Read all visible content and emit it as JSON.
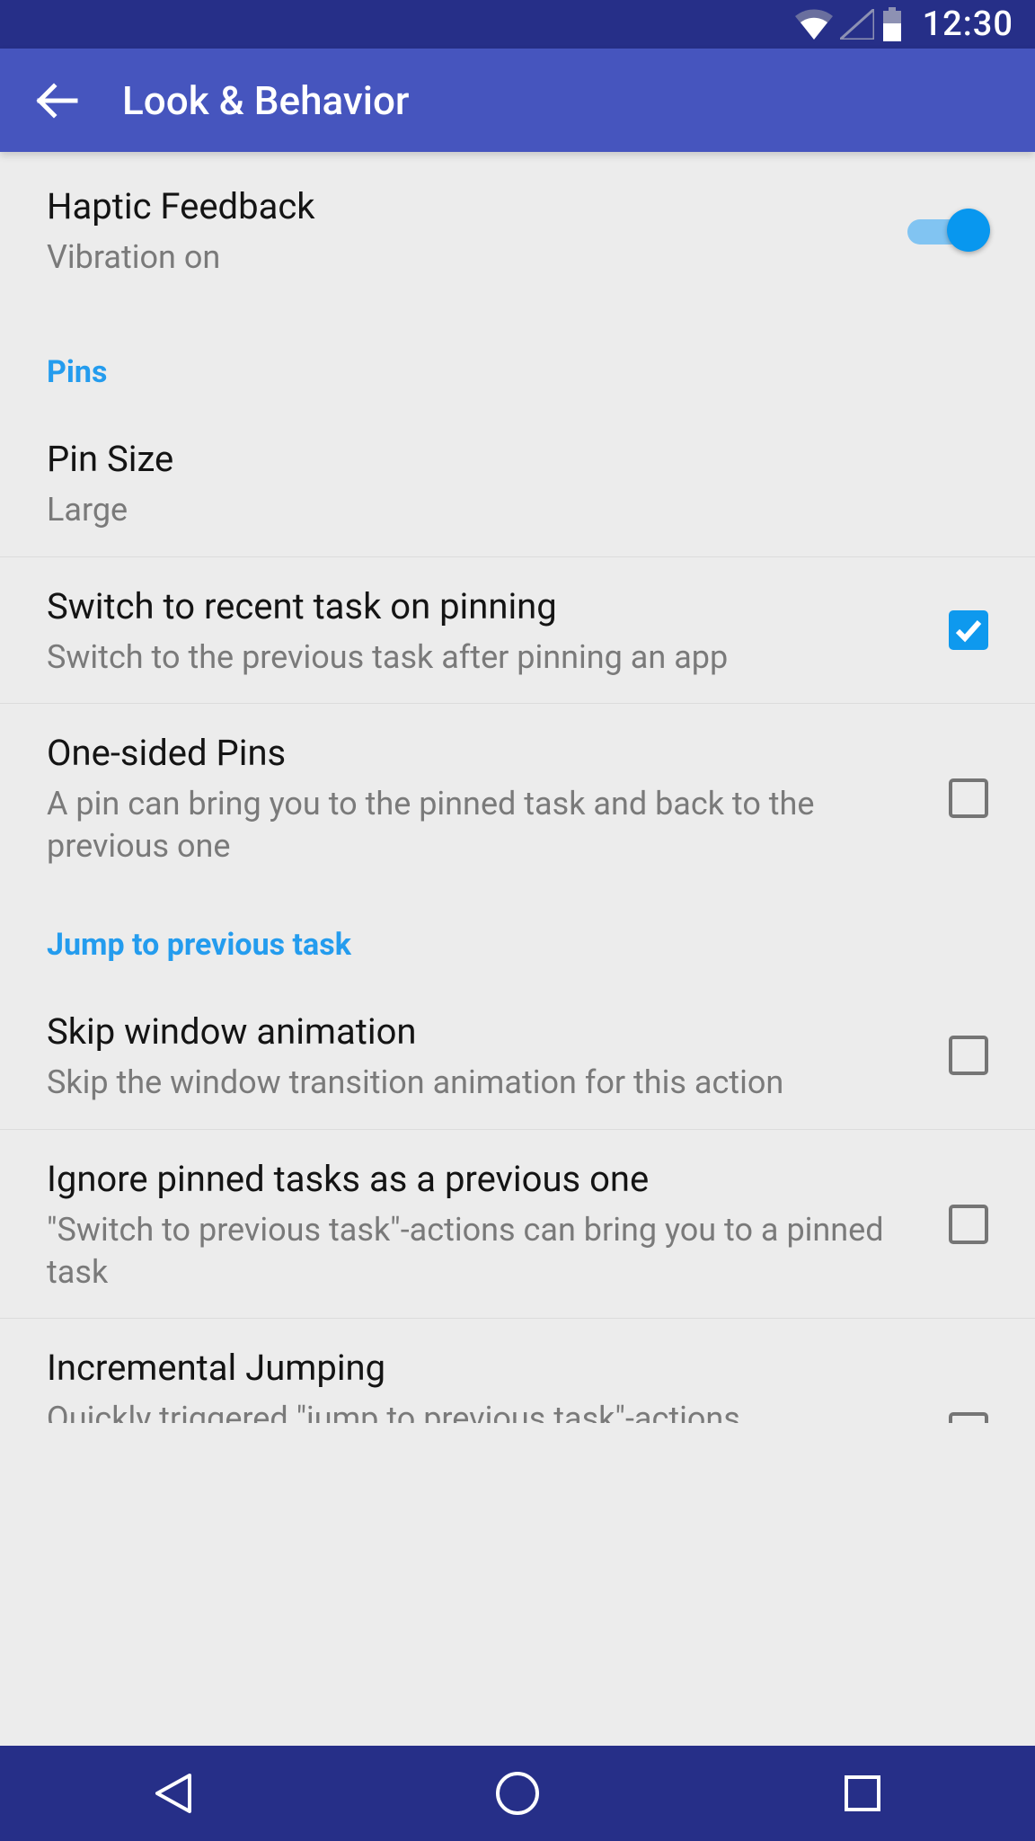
{
  "status": {
    "time": "12:30"
  },
  "appbar": {
    "title": "Look & Behavior"
  },
  "settings": {
    "haptic": {
      "title": "Haptic Feedback",
      "sub": "Vibration on"
    },
    "section_pins": "Pins",
    "pin_size": {
      "title": "Pin Size",
      "sub": "Large"
    },
    "switch_recent": {
      "title": "Switch to recent task on pinning",
      "sub": "Switch to the previous task after pinning an app"
    },
    "one_sided": {
      "title": "One-sided Pins",
      "sub": "A pin can bring you to the pinned task and back to the previous one"
    },
    "section_jump": "Jump to previous task",
    "skip_anim": {
      "title": "Skip window animation",
      "sub": "Skip the window transition animation for this action"
    },
    "ignore_pinned": {
      "title": "Ignore pinned tasks as a previous one",
      "sub": "\"Switch to previous task\"-actions can bring you to a pinned task"
    },
    "incremental": {
      "title": "Incremental Jumping",
      "sub": "Quickly triggered \"jump to previous task\"-actions"
    }
  }
}
